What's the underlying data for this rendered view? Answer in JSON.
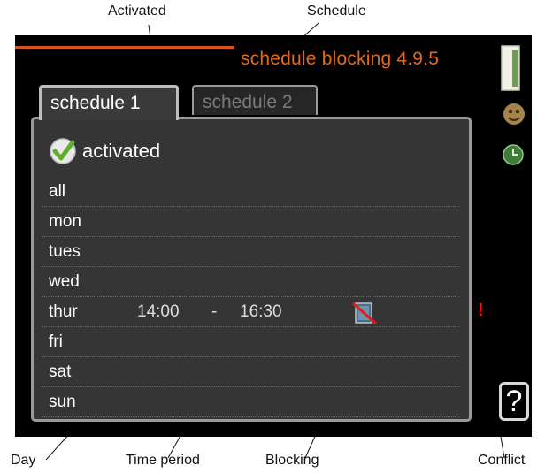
{
  "callouts": {
    "activated": "Activated",
    "schedule": "Schedule",
    "day": "Day",
    "time_period": "Time period",
    "blocking": "Blocking",
    "conflict": "Conflict"
  },
  "screen": {
    "title": "schedule blocking 4.9.5",
    "tabs": [
      {
        "label": "schedule 1",
        "active": true
      },
      {
        "label": "schedule 2",
        "active": false
      }
    ],
    "activated_label": "activated",
    "days": [
      {
        "label": "all"
      },
      {
        "label": "mon"
      },
      {
        "label": "tues"
      },
      {
        "label": "wed"
      },
      {
        "label": "thur",
        "from": "14:00",
        "separator": "-",
        "to": "16:30"
      },
      {
        "label": "fri"
      },
      {
        "label": "sat"
      },
      {
        "label": "sun"
      }
    ],
    "conflict_mark": "!",
    "help_label": "?"
  },
  "icons": [
    "check-icon",
    "blocking-icon",
    "conflict-icon",
    "display-icon",
    "face-icon",
    "clock-icon",
    "help-icon"
  ],
  "colors": {
    "title": "#e26a1a",
    "accent_line": "#d9541a",
    "check": "#5fae2e",
    "conflict": "#e11111"
  }
}
